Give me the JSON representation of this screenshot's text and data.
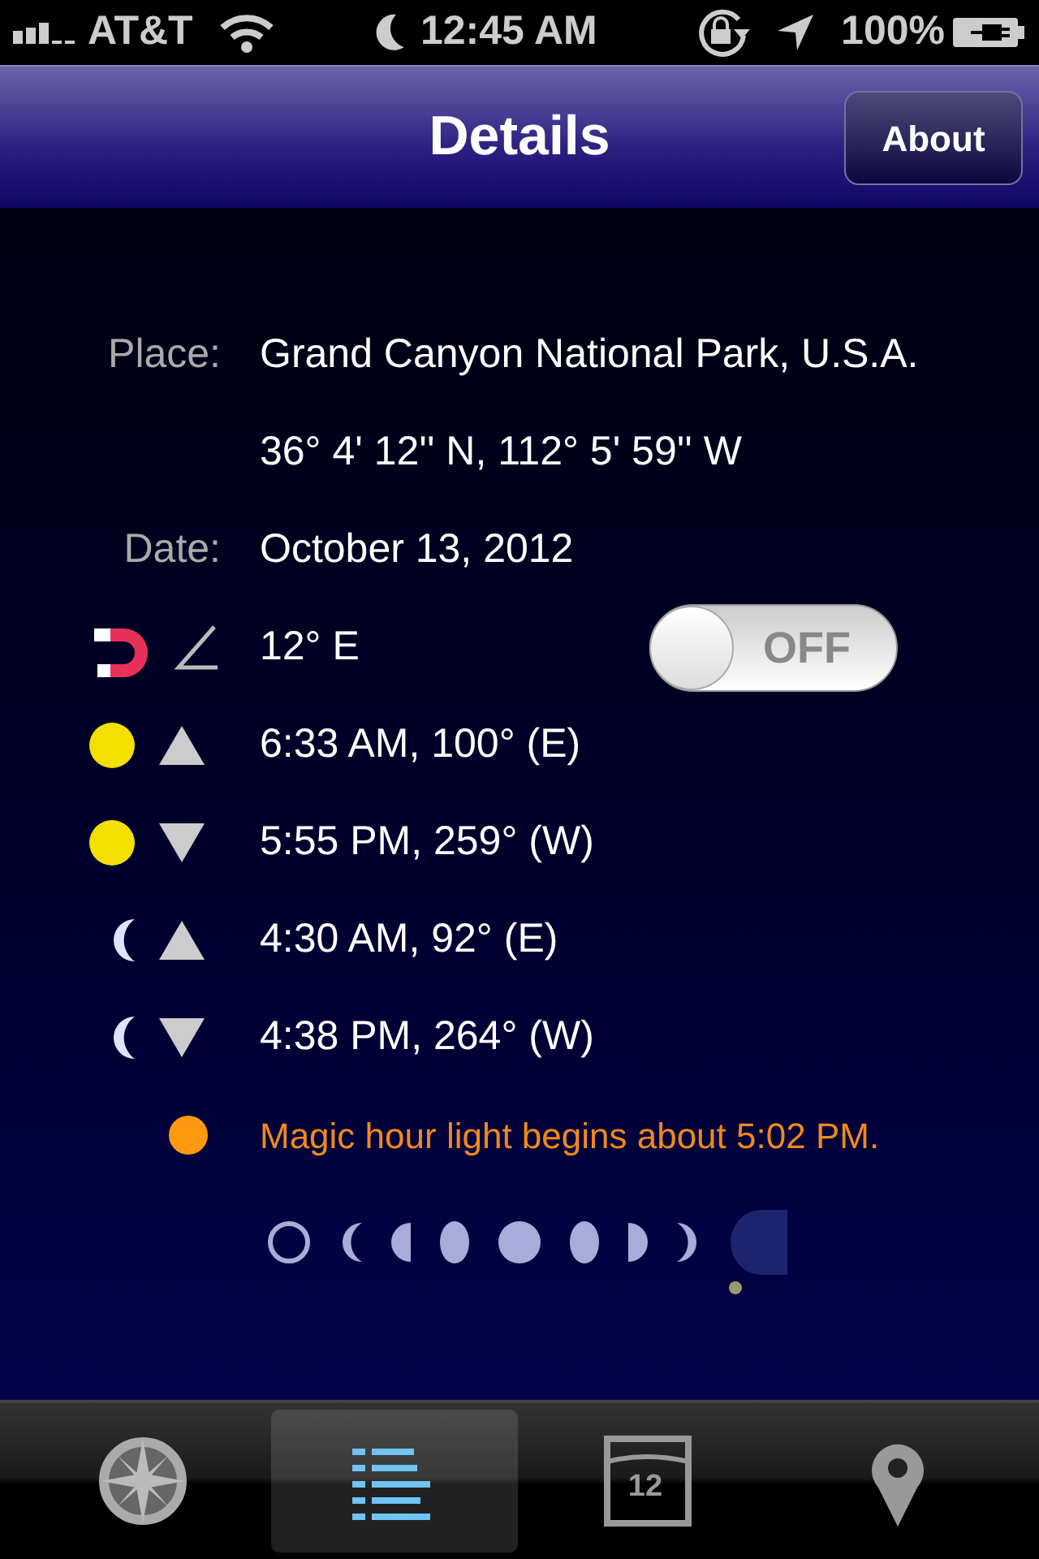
{
  "status_bar": {
    "carrier": "AT&T",
    "time": "12:45 AM",
    "battery": "100%"
  },
  "nav": {
    "title": "Details",
    "button": "About"
  },
  "details": [
    {
      "label": "Place:",
      "value": "Grand Canyon National Park, U.S.A."
    },
    {
      "value": "36° 4' 12'' N, 112° 5' 59'' W"
    },
    {
      "label": "Date:",
      "value": "October 13, 2012"
    }
  ],
  "declination": {
    "value": "12° E",
    "toggle": {
      "label": "OFF",
      "on": false
    }
  },
  "events": [
    {
      "kind": "sunrise",
      "text": "6:33 AM, 100° (E)"
    },
    {
      "kind": "sunset",
      "text": "5:55 PM, 259° (W)"
    },
    {
      "kind": "moonrise",
      "text": "4:30 AM, 92° (E)"
    },
    {
      "kind": "moonset",
      "text": "4:38 PM, 264° (W)"
    }
  ],
  "magic_hour": "Magic hour light begins about 5:02 PM.",
  "moon_phases": [
    {
      "selected": false
    },
    {
      "selected": false
    },
    {
      "selected": false
    },
    {
      "selected": false
    },
    {
      "selected": false
    },
    {
      "selected": false
    },
    {
      "selected": false
    },
    {
      "selected": false
    },
    {
      "selected": true
    }
  ],
  "tabs": [
    {
      "selected": false
    },
    {
      "selected": true
    },
    {
      "label": "12",
      "selected": false
    },
    {
      "selected": false
    }
  ]
}
